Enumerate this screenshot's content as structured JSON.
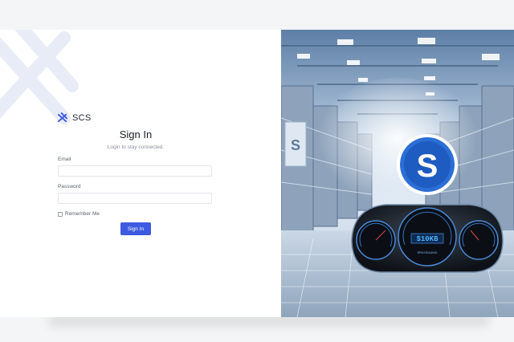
{
  "brand": {
    "name": "SCS",
    "icon": "scs-logo-icon"
  },
  "form": {
    "title": "Sign In",
    "subtitle": "Login to stay connected.",
    "email_label": "Email",
    "email_value": "",
    "password_label": "Password",
    "password_value": "",
    "remember_label": "Remember Me",
    "remember_checked": false,
    "submit_label": "Sign In"
  },
  "hero": {
    "logo_letter": "S",
    "gauge_display": "$10KB",
    "gauge_subtext": "RPM READING"
  },
  "colors": {
    "accent": "#3d5ae0",
    "hero_blue": "#2b6fd6"
  }
}
